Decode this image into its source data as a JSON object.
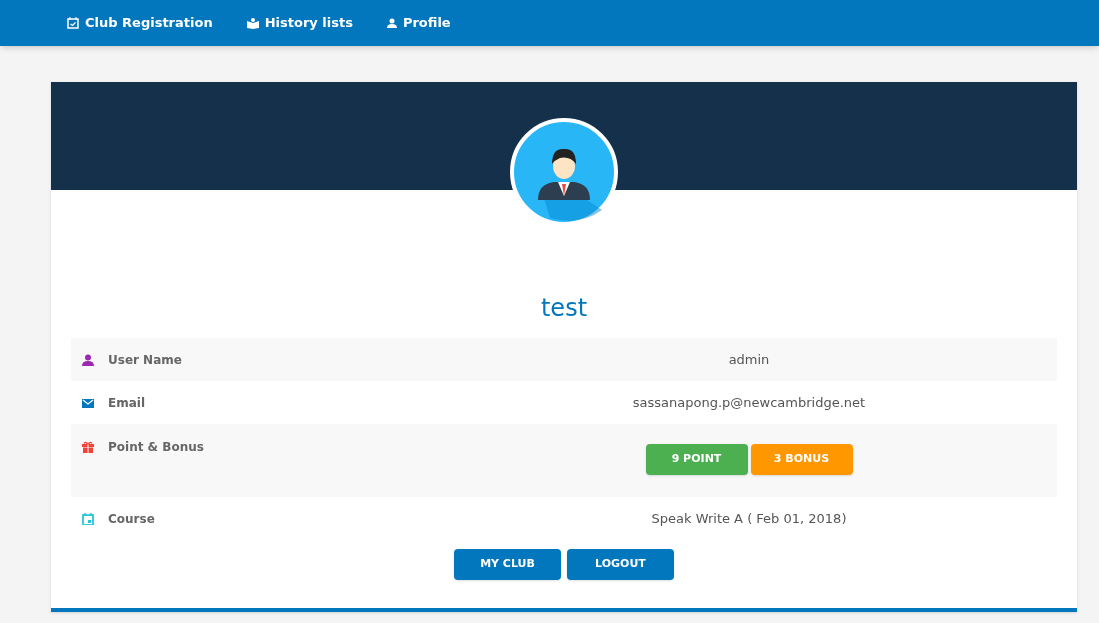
{
  "nav": [
    {
      "label": "Club Registration"
    },
    {
      "label": "History lists"
    },
    {
      "label": "Profile"
    }
  ],
  "profile": {
    "name": "test"
  },
  "rows": [
    {
      "kind": "text",
      "label": "User Name",
      "value": "admin",
      "color": "#9c27b0"
    },
    {
      "kind": "text",
      "label": "Email",
      "value": "sassanapong.p@newcambridge.net",
      "color": "#0277bd"
    },
    {
      "kind": "badges",
      "label": "Point & Bonus",
      "badges": [
        {
          "text": "9 POINT",
          "color": "#4caf50"
        },
        {
          "text": "3 BONUS",
          "color": "#ff9800"
        }
      ],
      "color": "#f44336"
    },
    {
      "kind": "text",
      "label": "Course",
      "value": "Speak Write A ( Feb 01, 2018)",
      "color": "#26c6da"
    }
  ],
  "buttons": [
    "MY CLUB",
    "LOGOUT"
  ]
}
